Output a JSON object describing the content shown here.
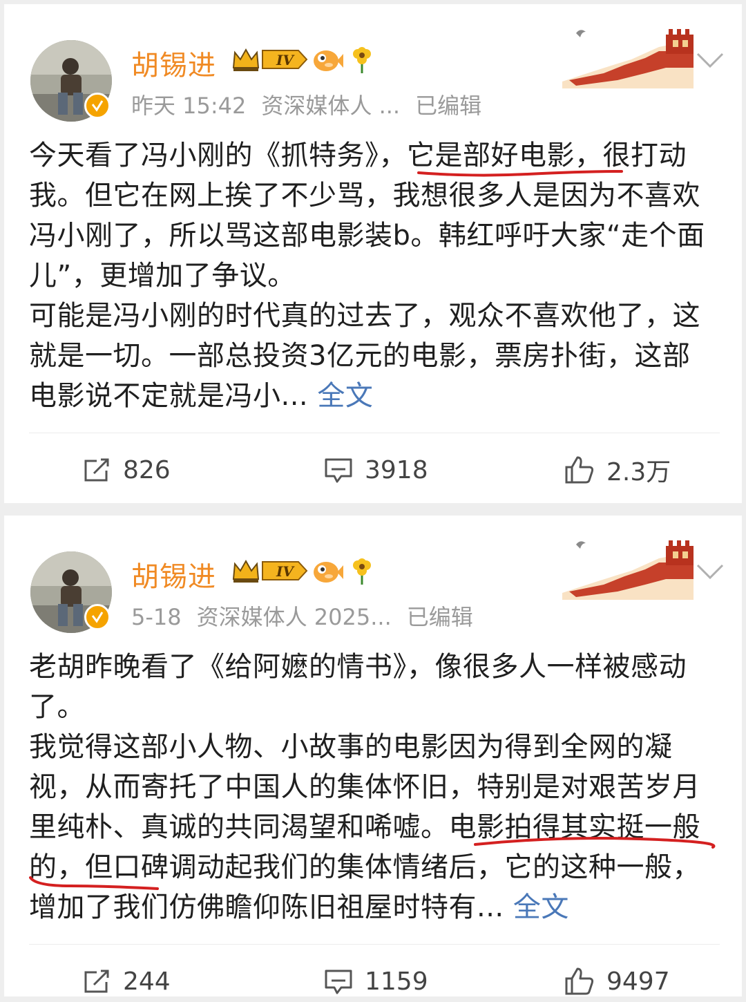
{
  "posts": [
    {
      "username": "胡锡进",
      "level_badge": "IV",
      "time": "昨天 15:42",
      "source": "资深媒体人 ...",
      "edited": "已编辑",
      "paragraphs": [
        "今天看了冯小刚的《抓特务》，它是部好电影，很打动我。但它在网上挨了不少骂，我想很多人是因为不喜欢冯小刚了，所以骂这部电影装b。韩红呼吁大家“走个面儿”，更增加了争议。",
        "可能是冯小刚的时代真的过去了，观众不喜欢他了，这就是一切。一部总投资3亿元的电影，票房扑街，这部电影说不定就是冯小..."
      ],
      "full_text_link": "全文",
      "repost_count": "826",
      "comment_count": "3918",
      "like_count": "2.3万"
    },
    {
      "username": "胡锡进",
      "level_badge": "IV",
      "time": "5-18",
      "source": "资深媒体人 2025...",
      "edited": "已编辑",
      "paragraphs": [
        "老胡昨晚看了《给阿嬷的情书》，像很多人一样被感动了。",
        "我觉得这部小人物、小故事的电影因为得到全网的凝视，从而寄托了中国人的集体怀旧，特别是对艰苦岁月里纯朴、真诚的共同渴望和唏嘘。电影拍得其实挺一般的，但口碑调动起我们的集体情绪后，它的这种一般，增加了我们仿佛瞻仰陈旧祖屋时特有..."
      ],
      "full_text_link": "全文",
      "repost_count": "244",
      "comment_count": "1159",
      "like_count": "9497"
    }
  ],
  "colors": {
    "username": "#f08a24",
    "link": "#4a78b8",
    "underline": "#d42020",
    "meta": "#9a9a9a"
  },
  "icons": [
    "repost-icon",
    "comment-icon",
    "like-icon",
    "chevron-down-icon",
    "verified-badge-icon",
    "crown-icon",
    "fish-icon",
    "flower-icon",
    "great-wall-decoration"
  ]
}
